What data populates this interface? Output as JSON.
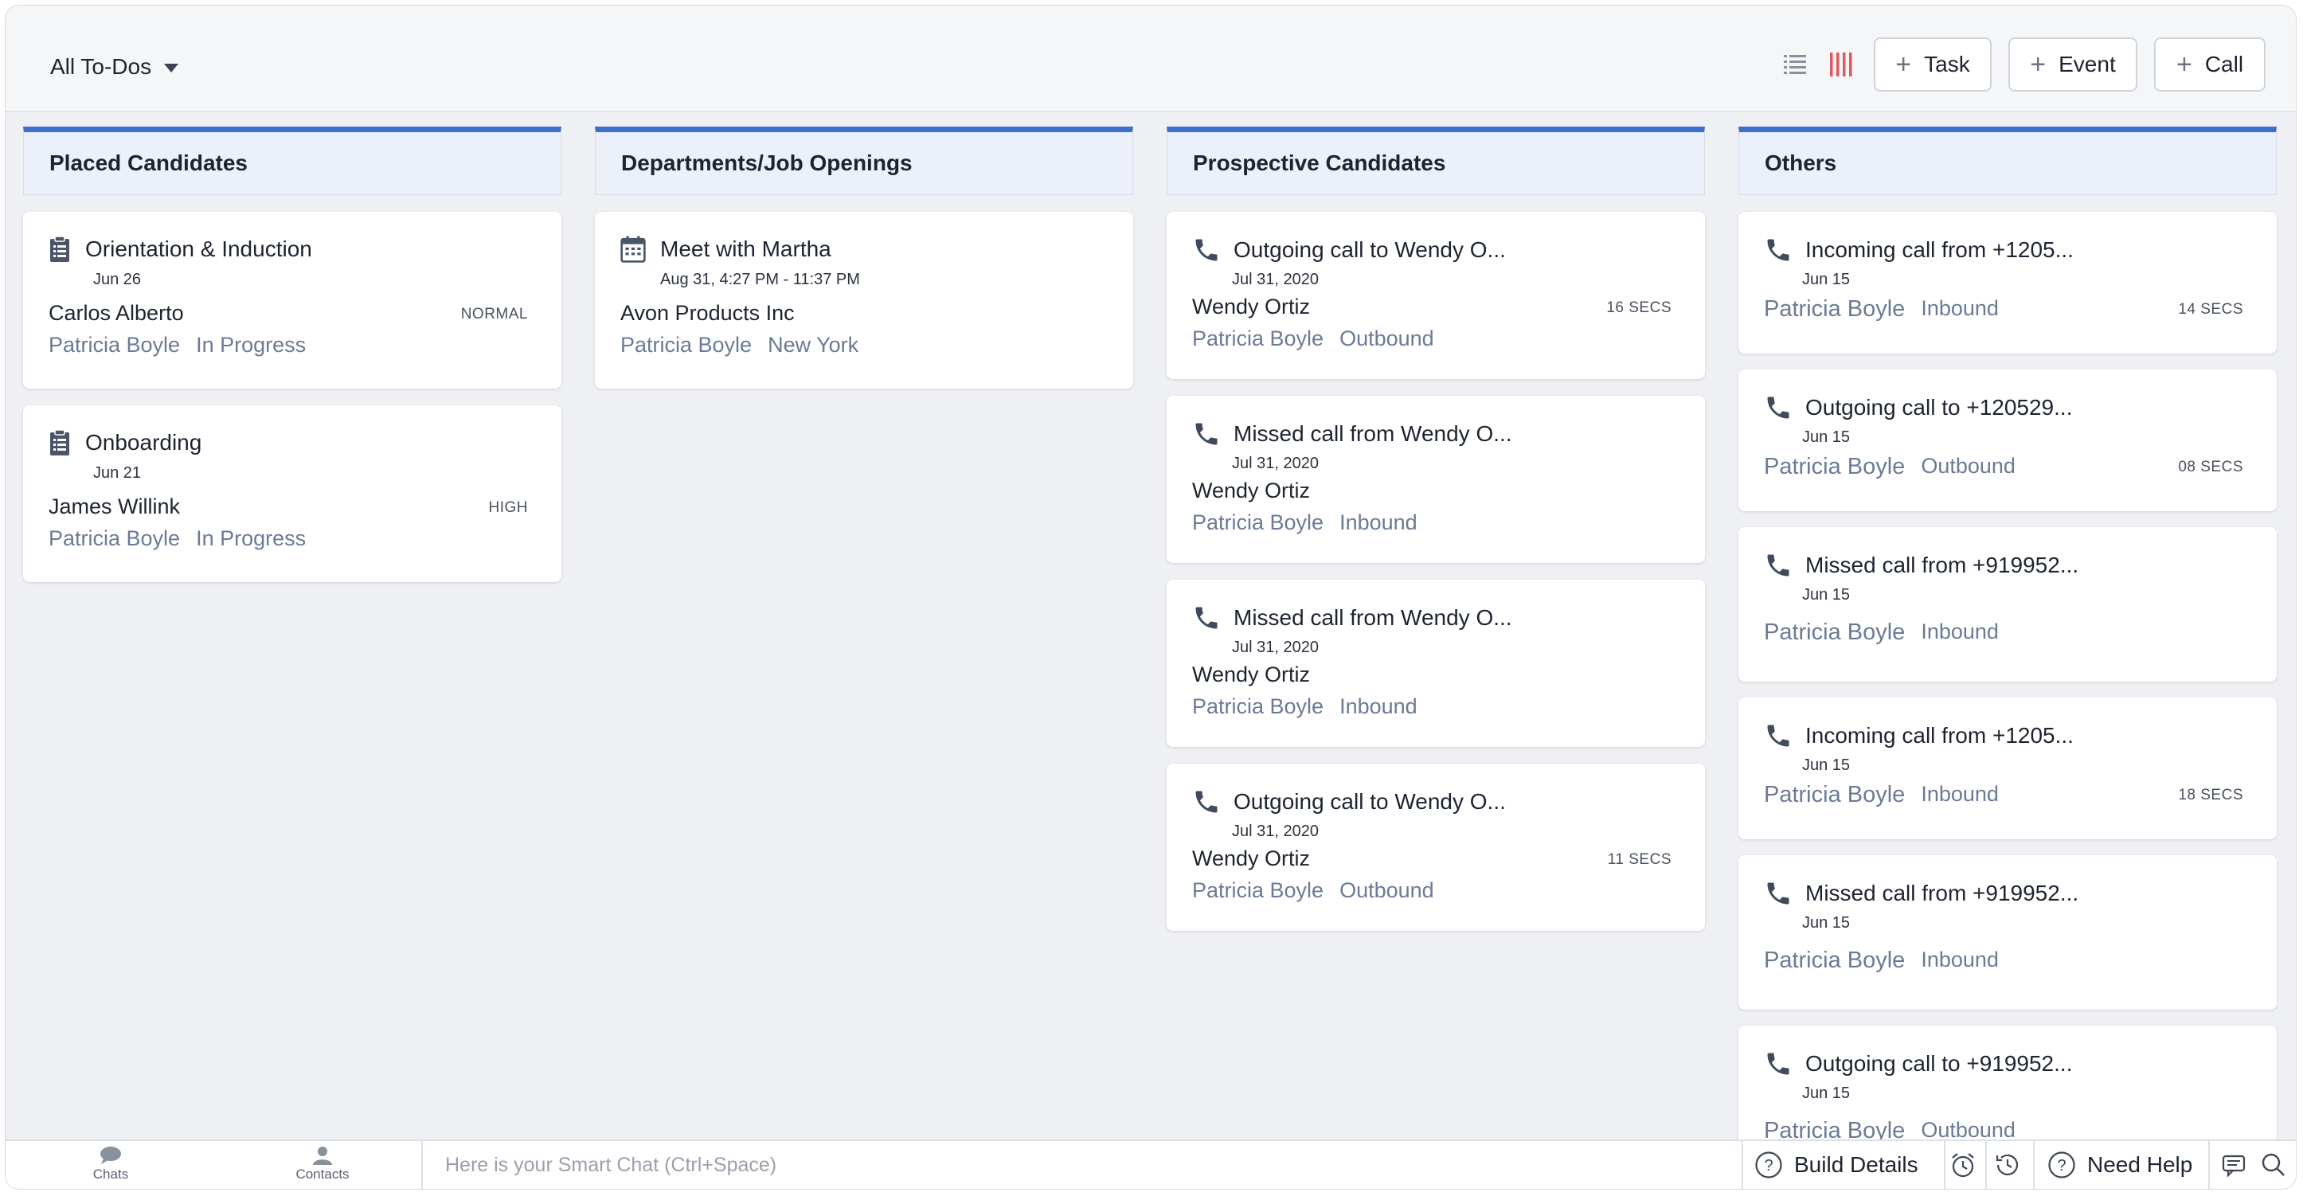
{
  "header": {
    "view_label": "All To-Dos",
    "buttons": {
      "task": "Task",
      "event": "Event",
      "call": "Call"
    },
    "colors": {
      "kanban_icon": "#e0575d",
      "accent": "#3e6fce"
    }
  },
  "columns": [
    {
      "title": "Placed Candidates",
      "cards": [
        {
          "icon": "clipboard-icon",
          "title": "Orientation & Induction",
          "date": "Jun 26",
          "subject": "Carlos Alberto",
          "owner": "Patricia Boyle",
          "detail": "In Progress",
          "badge": "NORMAL"
        },
        {
          "icon": "clipboard-icon",
          "title": "Onboarding",
          "date": "Jun 21",
          "subject": "James Willink",
          "owner": "Patricia Boyle",
          "detail": "In Progress",
          "badge": "HIGH"
        }
      ]
    },
    {
      "title": "Departments/Job Openings",
      "cards": [
        {
          "icon": "calendar-icon",
          "title": "Meet with Martha",
          "date": "Aug 31, 4:27 PM - 11:37 PM",
          "subject": "Avon Products Inc",
          "owner": "Patricia Boyle",
          "detail": "New York",
          "badge": ""
        }
      ]
    },
    {
      "title": "Prospective Candidates",
      "cards": [
        {
          "icon": "phone-icon",
          "title": "Outgoing call to Wendy O...",
          "date": "Jul 31, 2020",
          "subject": "Wendy Ortiz",
          "owner": "Patricia Boyle",
          "detail": "Outbound",
          "badge": "16 SECS"
        },
        {
          "icon": "phone-icon",
          "title": "Missed call from Wendy O...",
          "date": "Jul 31, 2020",
          "subject": "Wendy Ortiz",
          "owner": "Patricia Boyle",
          "detail": "Inbound",
          "badge": ""
        },
        {
          "icon": "phone-icon",
          "title": "Missed call from Wendy O...",
          "date": "Jul 31, 2020",
          "subject": "Wendy Ortiz",
          "owner": "Patricia Boyle",
          "detail": "Inbound",
          "badge": ""
        },
        {
          "icon": "phone-icon",
          "title": "Outgoing call to Wendy O...",
          "date": "Jul 31, 2020",
          "subject": "Wendy Ortiz",
          "owner": "Patricia Boyle",
          "detail": "Outbound",
          "badge": "11 SECS"
        }
      ]
    },
    {
      "title": "Others",
      "cards": [
        {
          "icon": "phone-icon",
          "title": "Incoming call from +1205...",
          "date": "Jun 15",
          "owner": "Patricia Boyle",
          "detail": "Inbound",
          "badge": "14 SECS"
        },
        {
          "icon": "phone-icon",
          "title": "Outgoing call to +120529...",
          "date": "Jun 15",
          "owner": "Patricia Boyle",
          "detail": "Outbound",
          "badge": "08 SECS"
        },
        {
          "icon": "phone-icon",
          "title": "Missed call from +919952...",
          "date": "Jun 15",
          "owner": "Patricia Boyle",
          "detail": "Inbound",
          "badge": ""
        },
        {
          "icon": "phone-icon",
          "title": "Incoming call from +1205...",
          "date": "Jun 15",
          "owner": "Patricia Boyle",
          "detail": "Inbound",
          "badge": "18 SECS"
        },
        {
          "icon": "phone-icon",
          "title": "Missed call from +919952...",
          "date": "Jun 15",
          "owner": "Patricia Boyle",
          "detail": "Inbound",
          "badge": ""
        },
        {
          "icon": "phone-icon",
          "title": "Outgoing call to +919952...",
          "date": "Jun 15",
          "owner": "Patricia Boyle",
          "detail": "Outbound",
          "badge": ""
        }
      ]
    }
  ],
  "footer": {
    "chats_label": "Chats",
    "contacts_label": "Contacts",
    "smart_chat_placeholder": "Here is your Smart Chat (Ctrl+Space)",
    "build_details_label": "Build Details",
    "need_help_label": "Need Help"
  }
}
